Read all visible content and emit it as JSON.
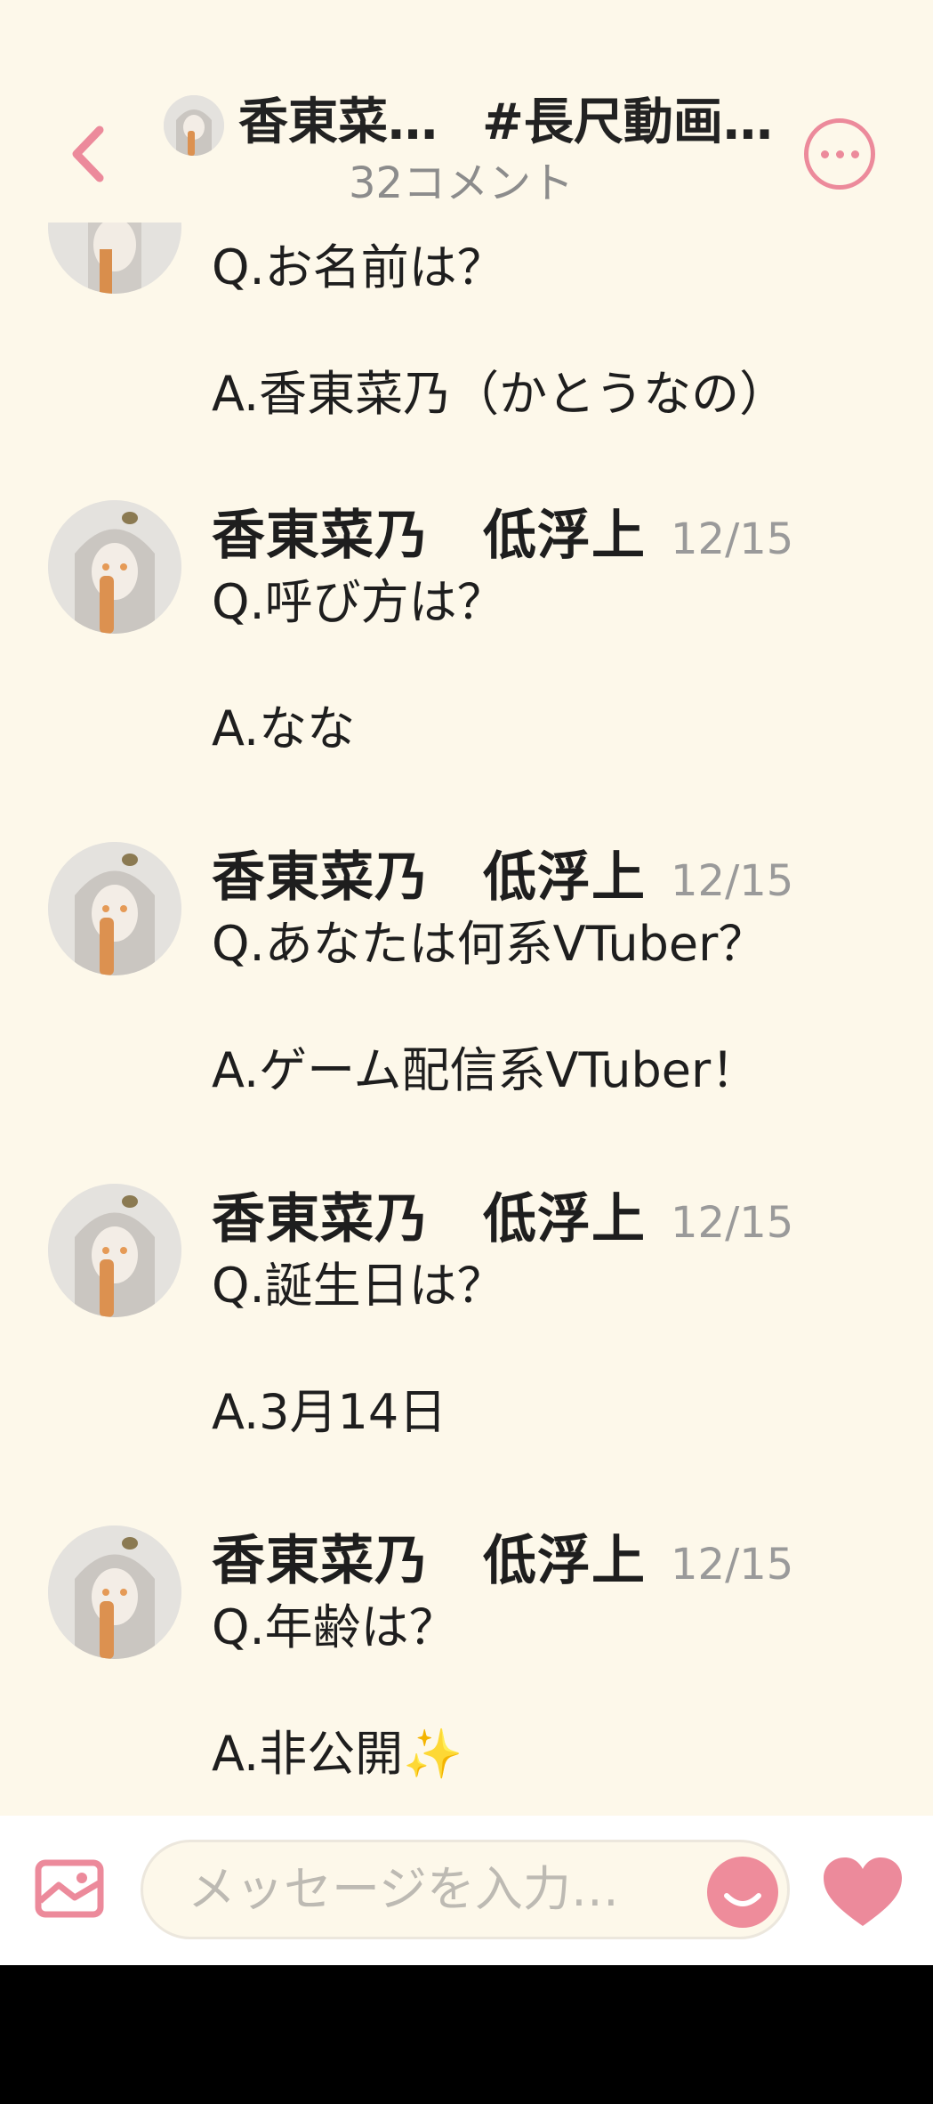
{
  "header": {
    "title_name": "香東菜…",
    "title_tag": "#長尺動画…",
    "subtitle": "32コメント"
  },
  "messages": [
    {
      "q": "Q.お名前は？",
      "a": "A.香東菜乃（かとうなの）"
    },
    {
      "name": "香東菜乃　低浮上",
      "date": "12/15",
      "q": "Q.呼び方は？",
      "a": "A.なな"
    },
    {
      "name": "香東菜乃　低浮上",
      "date": "12/15",
      "q": "Q.あなたは何系VTuber？",
      "a": "A.ゲーム配信系VTuber！"
    },
    {
      "name": "香東菜乃　低浮上",
      "date": "12/15",
      "q": "Q.誕生日は？",
      "a": "A.3月14日"
    },
    {
      "name": "香東菜乃　低浮上",
      "date": "12/15",
      "q": "Q.年齢は？",
      "a": "A.非公開✨"
    }
  ],
  "composer": {
    "placeholder": "メッセージを入力…"
  },
  "colors": {
    "accent": "#ec8a9b",
    "background": "#fdf8ea"
  },
  "icons": [
    "back-arrow-icon",
    "more-options-icon",
    "image-icon",
    "smiley-icon",
    "heart-icon"
  ]
}
